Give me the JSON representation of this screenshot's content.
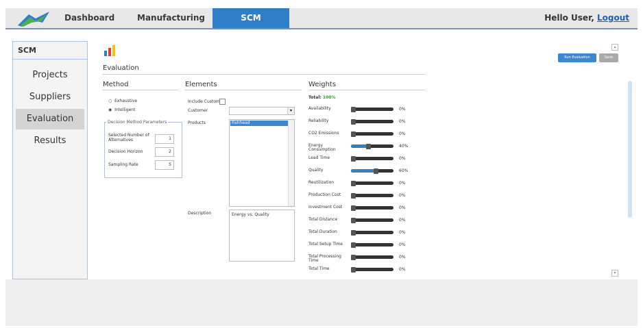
{
  "header": {
    "nav": [
      "Dashboard",
      "Manufacturing",
      "SCM"
    ],
    "greeting": "Hello User,",
    "logout": "Logout"
  },
  "sidebar": {
    "title": "SCM",
    "items": [
      "Projects",
      "Suppliers",
      "Evaluation",
      "Results"
    ],
    "selected": "Evaluation"
  },
  "page": {
    "title": "Evaluation",
    "buttons": {
      "run": "Run Evaluation",
      "save": "Save"
    }
  },
  "method": {
    "title": "Method",
    "options": [
      "Exhaustive",
      "Intelligent"
    ],
    "selected": "Intelligent",
    "params_title": "Decision Method Parameters",
    "params": [
      {
        "label": "Selected Number of Alternatives",
        "value": "1"
      },
      {
        "label": "Decision Horizon",
        "value": "2"
      },
      {
        "label": "Sampling Rate",
        "value": "5"
      }
    ]
  },
  "elements": {
    "title": "Elements",
    "include_customer": "Include Customer",
    "customer_label": "Customer",
    "customer_value": "",
    "products_label": "Products",
    "products": [
      "Fishhead"
    ],
    "description_label": "Description",
    "description_value": "Energy vs. Quality"
  },
  "weights": {
    "title": "Weights",
    "total_label": "Total:",
    "total_value": "100%",
    "total_color": "#2aa02a",
    "accent": "#3a7ec0",
    "items": [
      {
        "label": "Availability",
        "value": 0,
        "display": "0%"
      },
      {
        "label": "Reliability",
        "value": 0,
        "display": "0%"
      },
      {
        "label": "CO2 Emissions",
        "value": 0,
        "display": "0%"
      },
      {
        "label": "Energy Consumption",
        "value": 40,
        "display": "40%"
      },
      {
        "label": "Lead Time",
        "value": 0,
        "display": "0%"
      },
      {
        "label": "Quality",
        "value": 60,
        "display": "60%"
      },
      {
        "label": "Reutilization",
        "value": 0,
        "display": "0%"
      },
      {
        "label": "Production Cost",
        "value": 0,
        "display": "0%"
      },
      {
        "label": "Investment Cost",
        "value": 0,
        "display": "0%"
      },
      {
        "label": "Total Distance",
        "value": 0,
        "display": "0%"
      },
      {
        "label": "Total Duration",
        "value": 0,
        "display": "0%"
      },
      {
        "label": "Total Setup Time",
        "value": 0,
        "display": "0%"
      },
      {
        "label": "Total Processing Time",
        "value": 0,
        "display": "0%"
      },
      {
        "label": "Total Time",
        "value": 0,
        "display": "0%"
      }
    ]
  }
}
